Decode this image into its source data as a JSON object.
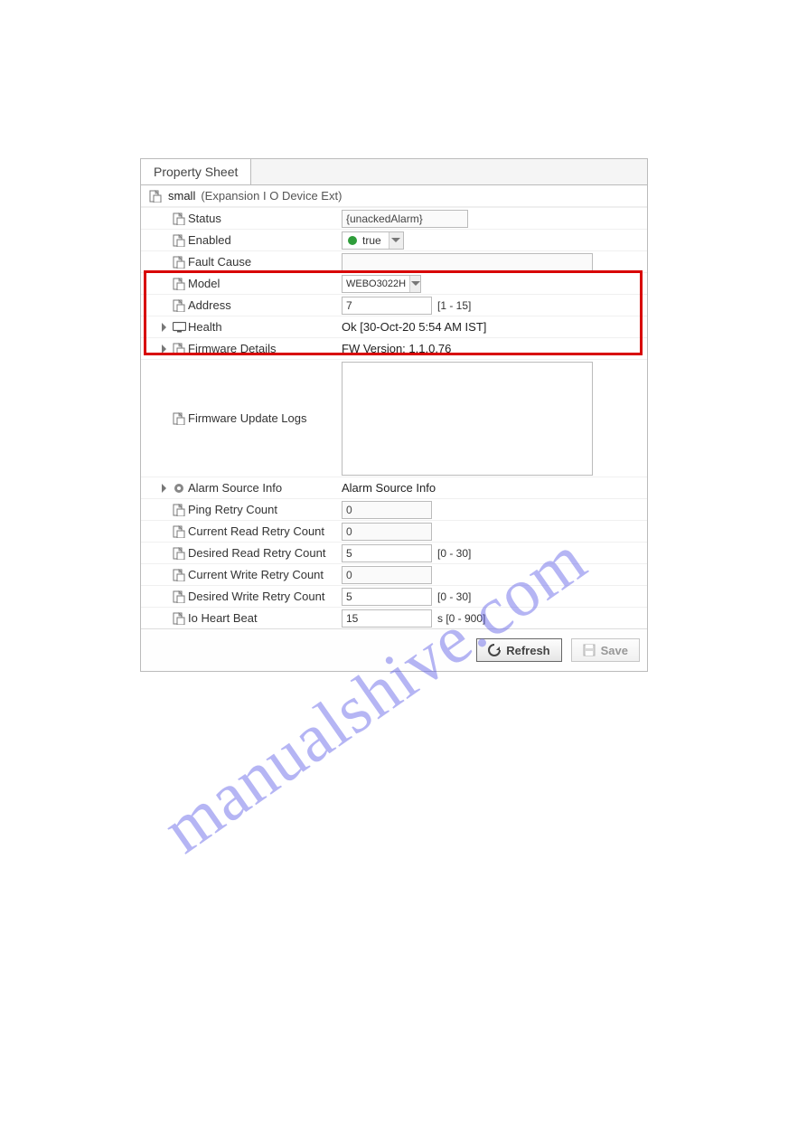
{
  "tab": {
    "title": "Property Sheet"
  },
  "header": {
    "name": "small",
    "suffix": "(Expansion I O Device Ext)"
  },
  "rows": {
    "status": {
      "label": "Status",
      "value": "{unackedAlarm}"
    },
    "enabled": {
      "label": "Enabled",
      "value": "true"
    },
    "faultCause": {
      "label": "Fault Cause",
      "value": ""
    },
    "model": {
      "label": "Model",
      "value": "WEBO3022H"
    },
    "address": {
      "label": "Address",
      "value": "7",
      "range": "[1 - 15]"
    },
    "health": {
      "label": "Health",
      "value": "Ok [30-Oct-20 5:54 AM IST]"
    },
    "firmwareDetails": {
      "label": "Firmware Details",
      "value": "FW Version: 1.1.0.76"
    },
    "firmwareUpdateLogs": {
      "label": "Firmware Update Logs"
    },
    "alarmSourceInfo": {
      "label": "Alarm Source Info",
      "value": "Alarm Source Info"
    },
    "pingRetryCount": {
      "label": "Ping Retry Count",
      "value": "0"
    },
    "currentReadRetryCount": {
      "label": "Current Read Retry Count",
      "value": "0"
    },
    "desiredReadRetryCount": {
      "label": "Desired Read Retry Count",
      "value": "5",
      "range": "[0 - 30]"
    },
    "currentWriteRetryCount": {
      "label": "Current Write Retry Count",
      "value": "0"
    },
    "desiredWriteRetryCount": {
      "label": "Desired Write Retry Count",
      "value": "5",
      "range": "[0 - 30]"
    },
    "ioHeartBeat": {
      "label": "Io Heart Beat",
      "value": "15",
      "range": "s [0 - 900]"
    }
  },
  "buttons": {
    "refresh": "Refresh",
    "save": "Save"
  },
  "watermark": "manualshive.com"
}
